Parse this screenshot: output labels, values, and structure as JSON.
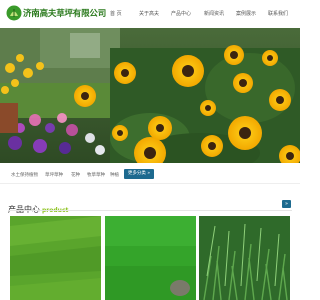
{
  "header": {
    "brand": "济南高夫草坪有限公司",
    "nav": [
      {
        "label": "首 页"
      },
      {
        "label": "关于高夫"
      },
      {
        "label": "产品中心"
      },
      {
        "label": "新闻资讯"
      },
      {
        "label": "案例展示"
      },
      {
        "label": "联系我们"
      }
    ]
  },
  "subbar": {
    "links": [
      "水土保持植物",
      "草坪草种",
      "花种",
      "牧草草种",
      "种植"
    ],
    "more_button": "更多分类 »"
  },
  "products_section": {
    "title_cn": "产品中心",
    "title_en": "product",
    "more_label": "»"
  },
  "colors": {
    "brand_green": "#2b7a1d",
    "accent_green": "#8dc21f",
    "button_blue": "#1d6a8f"
  },
  "icons": [
    "logo-icon"
  ]
}
